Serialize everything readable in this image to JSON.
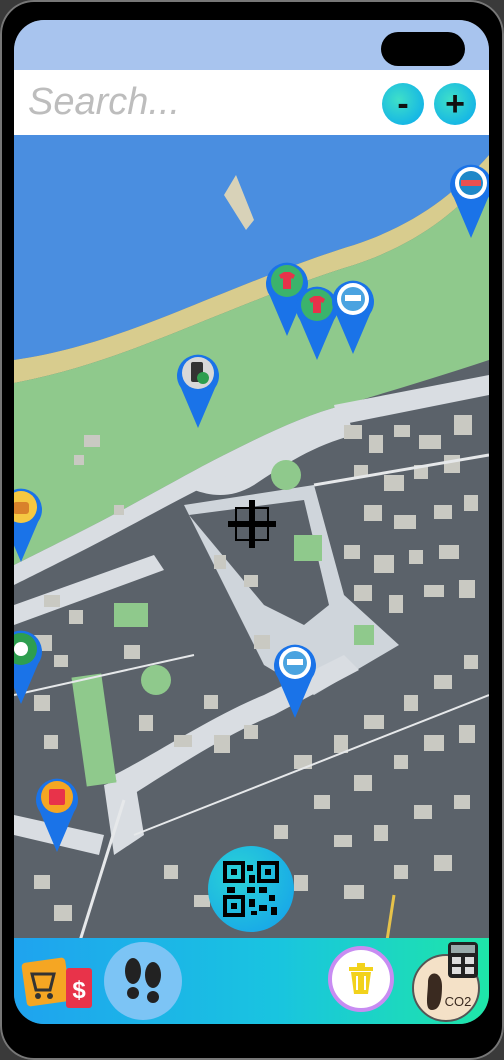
{
  "search": {
    "placeholder": "Search..."
  },
  "zoom": {
    "minus_label": "-",
    "plus_label": "+"
  },
  "pins": [
    {
      "name": "map-pin-brand-1",
      "icon": "badge-icon"
    },
    {
      "name": "map-pin-tshirt-1",
      "icon": "tshirt-icon"
    },
    {
      "name": "map-pin-tshirt-2",
      "icon": "tshirt-icon"
    },
    {
      "name": "map-pin-brand-2",
      "icon": "badge-icon"
    },
    {
      "name": "map-pin-recycle-phone",
      "icon": "recycle-phone-icon"
    },
    {
      "name": "map-pin-food",
      "icon": "food-icon"
    },
    {
      "name": "map-pin-green",
      "icon": "leaf-icon"
    },
    {
      "name": "map-pin-brand-3",
      "icon": "badge-icon"
    },
    {
      "name": "map-pin-shop",
      "icon": "shop-icon"
    }
  ],
  "bottom_nav": {
    "items": [
      "coupons-icon",
      "footsteps-icon",
      "trash-bin-icon",
      "co2-footprint-icon",
      "calculator-icon"
    ],
    "co2_label": "CO2"
  },
  "colors": {
    "pin": "#1a73e8",
    "park": "#8fc98c",
    "water": "#4a8ee0",
    "land": "#5b626a",
    "road": "#d9dde2",
    "accent": "#19c4e0"
  }
}
